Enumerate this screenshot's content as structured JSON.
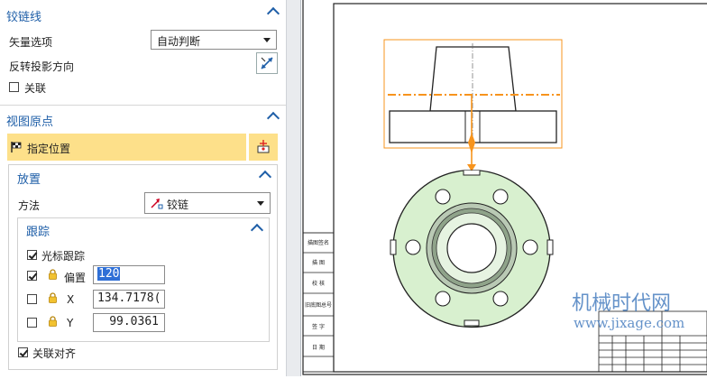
{
  "hinge_section": {
    "title": "铰链线",
    "vector_option_label": "矢量选项",
    "vector_option_value": "自动判断",
    "reverse_projection_label": "反转投影方向",
    "associate_label": "关联",
    "associate_checked": false
  },
  "view_origin_section": {
    "title": "视图原点",
    "specify_location_label": "指定位置"
  },
  "placement_section": {
    "title": "放置",
    "method_label": "方法",
    "method_value": "铰链"
  },
  "tracking_section": {
    "title": "跟踪",
    "cursor_tracking_label": "光标跟踪",
    "cursor_tracking_checked": true,
    "offset_label": "偏置",
    "offset_value": "120",
    "offset_checked": true,
    "x_label": "X",
    "x_value": "134.7178(",
    "x_checked": false,
    "y_label": "Y",
    "y_value": "99.0361",
    "y_checked": false
  },
  "associate_align_label": "关联对齐",
  "associate_align_checked": true,
  "watermark": {
    "title": "机械时代网",
    "url": "www.jixage.com"
  },
  "title_block_labels": [
    "描图签名",
    "描 图",
    "校 核",
    "旧底图总号",
    "签 字",
    "日 期"
  ],
  "colors": {
    "accent_blue": "#1f5fa8",
    "highlight_bar": "#fde08a",
    "preview_orange": "#f7941d",
    "part_green": "#d8f0cf"
  }
}
